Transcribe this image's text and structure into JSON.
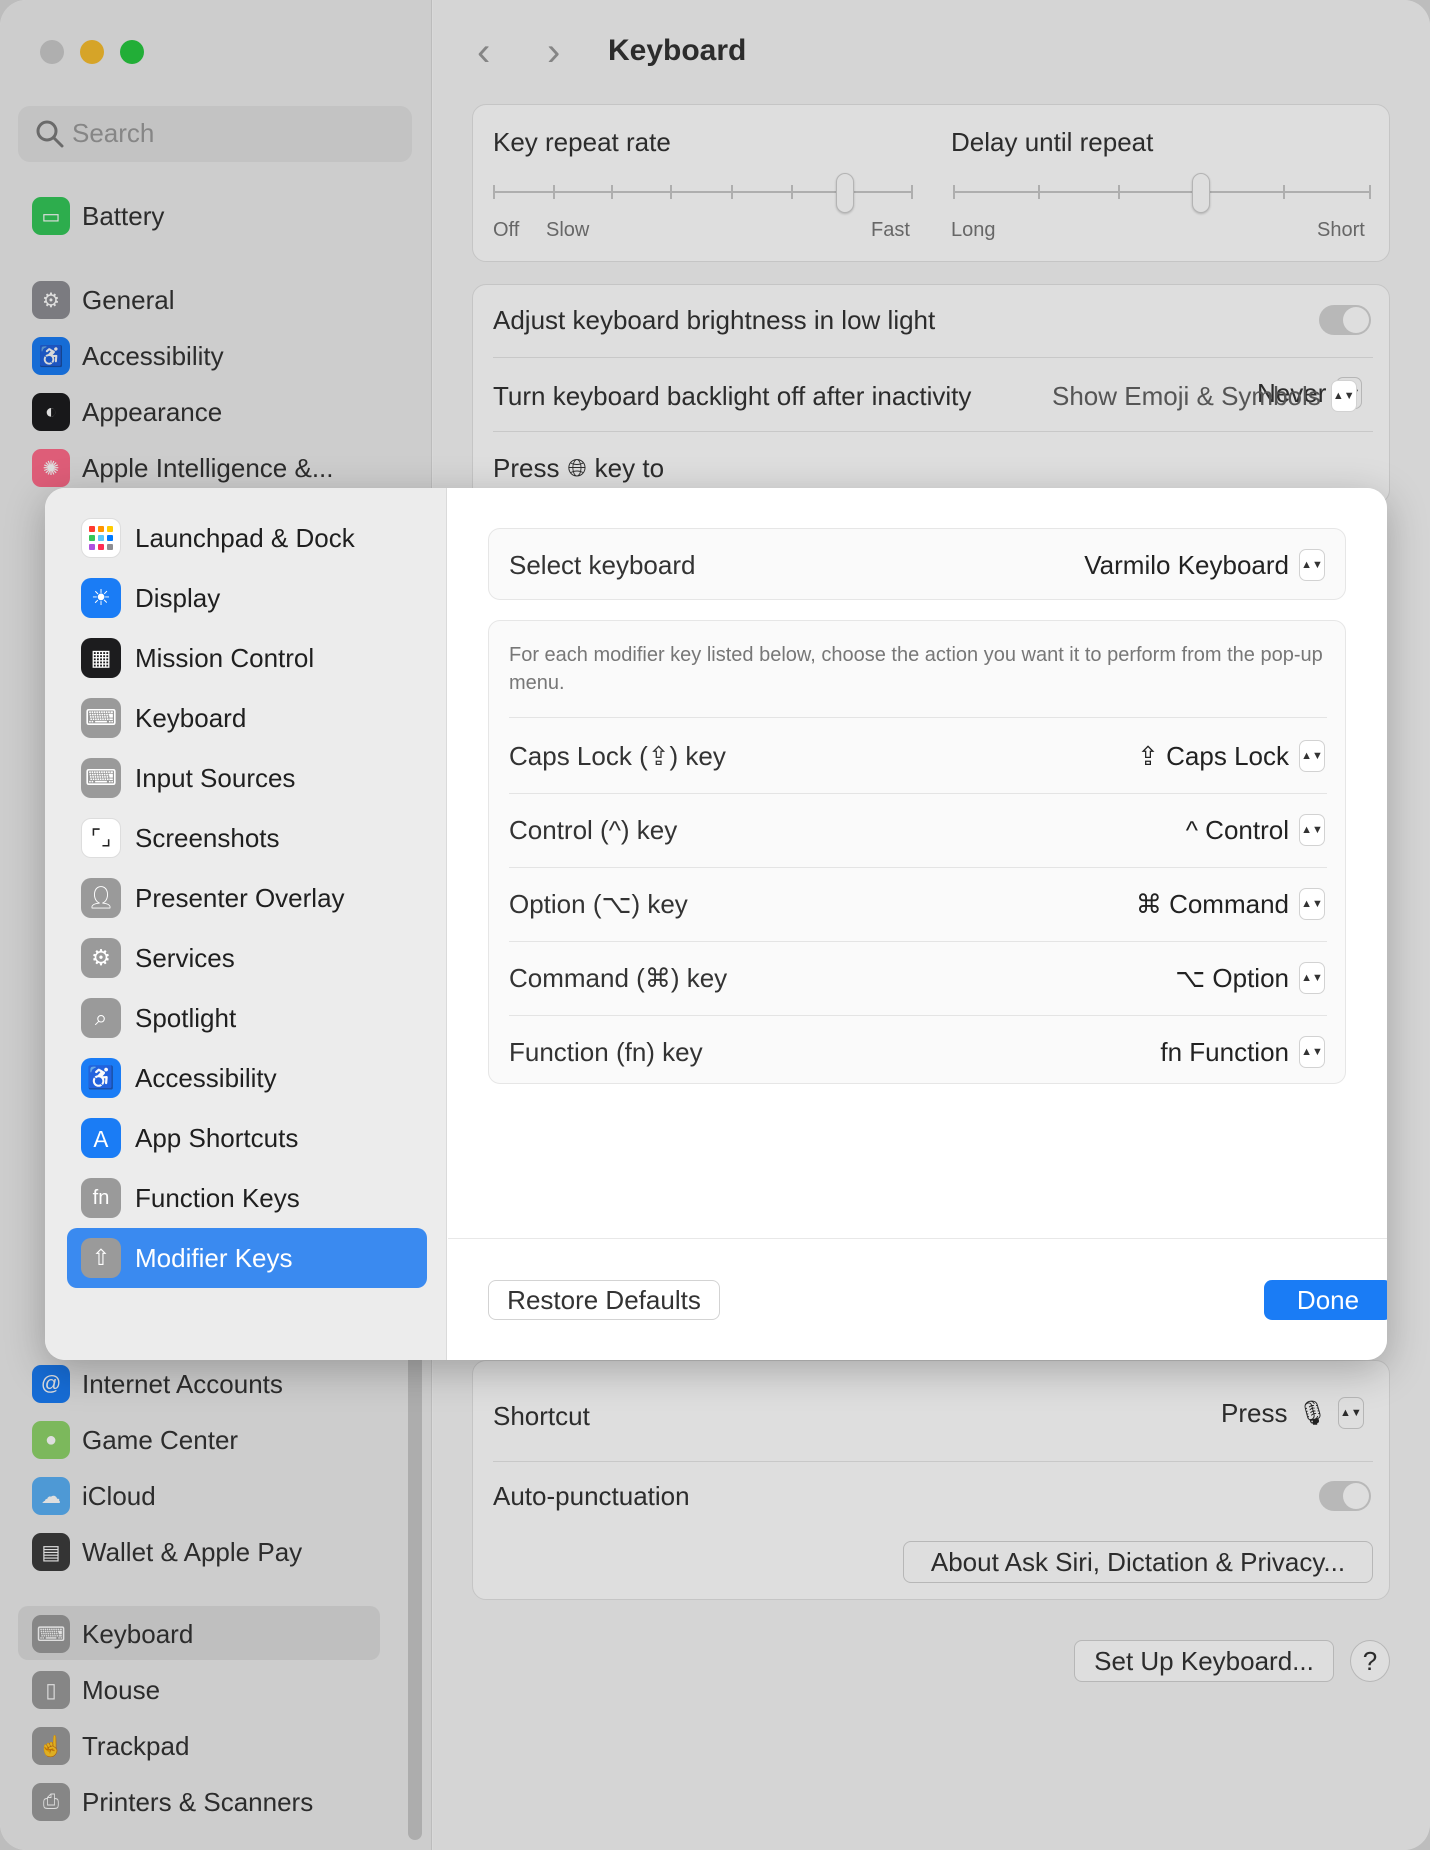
{
  "window": {
    "title": "Keyboard",
    "traffic_lights": {
      "close": "#c9c9c9",
      "minimize": "#f6bd2e",
      "zoom": "#28c840"
    }
  },
  "sidebar": {
    "search_placeholder": "Search",
    "items": [
      {
        "label": "Battery",
        "icon": "battery-icon",
        "color": "#34c759"
      },
      {
        "label": "General",
        "icon": "gear-icon",
        "color": "#8e8e93"
      },
      {
        "label": "Accessibility",
        "icon": "accessibility-icon",
        "color": "#1a7cf5"
      },
      {
        "label": "Appearance",
        "icon": "appearance-icon",
        "color": "#1c1c1e"
      },
      {
        "label": "Apple Intelligence &...",
        "icon": "apple-intelligence-icon",
        "color": "#ff6b8a"
      },
      {
        "label": "Internet Accounts",
        "icon": "at-icon",
        "color": "#1a7cf5"
      },
      {
        "label": "Game Center",
        "icon": "game-center-icon",
        "color": "#8fd46a"
      },
      {
        "label": "iCloud",
        "icon": "cloud-icon",
        "color": "#5ab0f5"
      },
      {
        "label": "Wallet & Apple Pay",
        "icon": "wallet-icon",
        "color": "#3c3c3c"
      },
      {
        "label": "Keyboard",
        "icon": "keyboard-icon",
        "color": "#9a9a9a"
      },
      {
        "label": "Mouse",
        "icon": "mouse-icon",
        "color": "#9a9a9a"
      },
      {
        "label": "Trackpad",
        "icon": "trackpad-icon",
        "color": "#9a9a9a"
      },
      {
        "label": "Printers & Scanners",
        "icon": "printer-icon",
        "color": "#9a9a9a"
      }
    ]
  },
  "main": {
    "key_repeat": {
      "label": "Key repeat rate",
      "min_label": "Off",
      "slow_label": "Slow",
      "max_label": "Fast",
      "ticks": 8,
      "value_index": 6
    },
    "delay_repeat": {
      "label": "Delay until repeat",
      "min_label": "Long",
      "max_label": "Short",
      "ticks": 6,
      "value_index": 3
    },
    "adjust_brightness_label": "Adjust keyboard brightness in low light",
    "backlight_off_label": "Turn keyboard backlight off after inactivity",
    "backlight_off_value": "Never",
    "press_key_label_pre": "Press",
    "press_key_label_post": "key to",
    "press_key_value": "Show Emoji & Symbols",
    "shortcut_label": "Shortcut",
    "shortcut_value": "Press",
    "auto_punct_label": "Auto-punctuation",
    "about_siri_button": "About Ask Siri, Dictation & Privacy...",
    "setup_keyboard_button": "Set Up Keyboard...",
    "help_button": "?"
  },
  "modal": {
    "sidebar": [
      {
        "label": "Launchpad & Dock",
        "icon": "launchpad-icon",
        "color": "#ffffff"
      },
      {
        "label": "Display",
        "icon": "display-icon",
        "color": "#1a7cf5"
      },
      {
        "label": "Mission Control",
        "icon": "mission-control-icon",
        "color": "#1c1c1e"
      },
      {
        "label": "Keyboard",
        "icon": "keyboard-icon",
        "color": "#9a9a9a"
      },
      {
        "label": "Input Sources",
        "icon": "input-sources-icon",
        "color": "#9a9a9a"
      },
      {
        "label": "Screenshots",
        "icon": "screenshot-icon",
        "color": "#ffffff"
      },
      {
        "label": "Presenter Overlay",
        "icon": "presenter-overlay-icon",
        "color": "#9a9a9a"
      },
      {
        "label": "Services",
        "icon": "services-icon",
        "color": "#9a9a9a"
      },
      {
        "label": "Spotlight",
        "icon": "spotlight-icon",
        "color": "#9a9a9a"
      },
      {
        "label": "Accessibility",
        "icon": "accessibility-icon",
        "color": "#1a7cf5"
      },
      {
        "label": "App Shortcuts",
        "icon": "app-shortcuts-icon",
        "color": "#1a7cf5"
      },
      {
        "label": "Function Keys",
        "icon": "fn-icon",
        "color": "#9a9a9a"
      },
      {
        "label": "Modifier Keys",
        "icon": "modifier-keys-icon",
        "color": "#9a9a9a",
        "selected": true
      }
    ],
    "select_keyboard_label": "Select keyboard",
    "select_keyboard_value": "Varmilo Keyboard",
    "description": "For each modifier key listed below, choose the action you want it to perform from the pop-up menu.",
    "rows": [
      {
        "label": "Caps Lock (⇪) key",
        "value": "⇪ Caps Lock"
      },
      {
        "label": "Control (^) key",
        "value": "^ Control"
      },
      {
        "label": "Option (⌥) key",
        "value": "⌘ Command"
      },
      {
        "label": "Command (⌘) key",
        "value": "⌥ Option"
      },
      {
        "label": "Function (fn) key",
        "value": "fn Function"
      }
    ],
    "restore_defaults": "Restore Defaults",
    "done": "Done"
  }
}
